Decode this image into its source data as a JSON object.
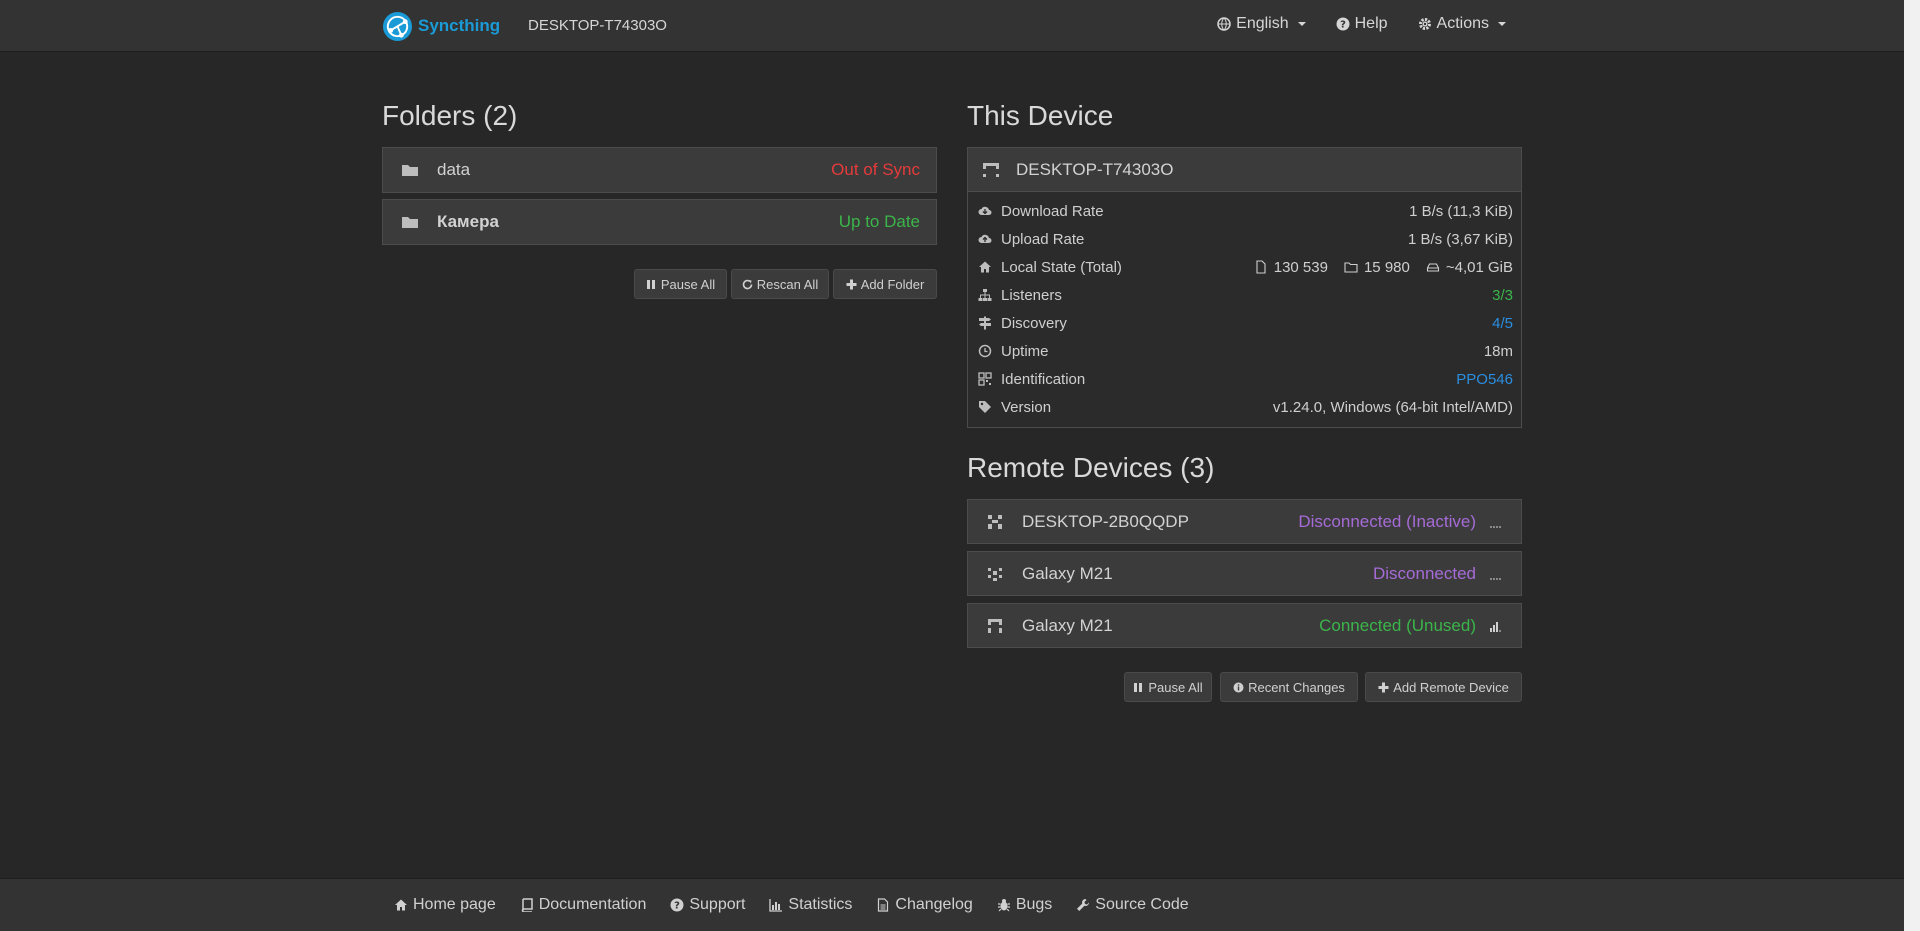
{
  "navbar": {
    "brand": "Syncthing",
    "device_name": "DESKTOP-T74303O",
    "language": "English",
    "help": "Help",
    "actions": "Actions"
  },
  "folders": {
    "heading": "Folders (2)",
    "items": [
      {
        "name": "data",
        "status": "Out of Sync"
      },
      {
        "name": "Камера",
        "status": "Up to Date"
      }
    ],
    "buttons": {
      "pause_all": "Pause All",
      "rescan_all": "Rescan All",
      "add_folder": "Add Folder"
    }
  },
  "this_device": {
    "heading": "This Device",
    "name": "DESKTOP-T74303O",
    "rows": {
      "download_label": "Download Rate",
      "download_value": "1 B/s (11,3 KiB)",
      "upload_label": "Upload Rate",
      "upload_value": "1 B/s (3,67 KiB)",
      "local_label": "Local State (Total)",
      "local_files": "130 539",
      "local_dirs": "15 980",
      "local_size": "~4,01 GiB",
      "listeners_label": "Listeners",
      "listeners_value": "3/3",
      "discovery_label": "Discovery",
      "discovery_value": "4/5",
      "uptime_label": "Uptime",
      "uptime_value": "18m",
      "id_label": "Identification",
      "id_value": "PPO546",
      "version_label": "Version",
      "version_value": "v1.24.0, Windows (64-bit Intel/AMD)"
    }
  },
  "remote_devices": {
    "heading": "Remote Devices (3)",
    "items": [
      {
        "name": "DESKTOP-2B0QQDP",
        "status": "Disconnected (Inactive)"
      },
      {
        "name": "Galaxy M21",
        "status": "Disconnected"
      },
      {
        "name": "Galaxy M21",
        "status": "Connected (Unused)"
      }
    ],
    "buttons": {
      "pause_all": "Pause All",
      "recent_changes": "Recent Changes",
      "add_remote": "Add Remote Device"
    }
  },
  "footer": {
    "links": [
      "Home page",
      "Documentation",
      "Support",
      "Statistics",
      "Changelog",
      "Bugs",
      "Source Code"
    ]
  },
  "colors": {
    "accent": "#1a9bd7",
    "out_of_sync": "#e53b3b",
    "up_to_date": "#3bb54a",
    "disconnected": "#a66bd6",
    "link": "#2a8ee0"
  }
}
